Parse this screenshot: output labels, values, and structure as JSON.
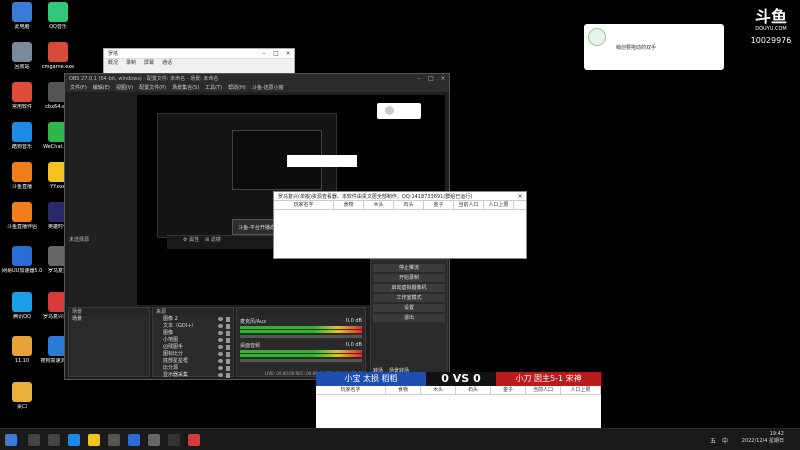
{
  "desktop_icons": [
    {
      "label": "此电脑",
      "color": "#3a7bd5"
    },
    {
      "label": "QQ音乐",
      "color": "#30c77a"
    },
    {
      "label": "回收站",
      "color": "#7a8a9a"
    },
    {
      "label": "cmgame.exe",
      "color": "#d64b3b"
    },
    {
      "label": "常用软件",
      "color": "#e04a3a"
    },
    {
      "label": "cbx64.exe",
      "color": "#555555"
    },
    {
      "label": "酷狗音乐",
      "color": "#1a8ce8"
    },
    {
      "label": "WeChat.exe",
      "color": "#2db64b"
    },
    {
      "label": "斗鱼直播",
      "color": "#f07d1a"
    },
    {
      "label": "YY.exe",
      "color": "#f4c21f"
    },
    {
      "label": "斗鱼直播伴侣",
      "color": "#f07d1a"
    },
    {
      "label": "英雄时代",
      "color": "#2a2a6a"
    },
    {
      "label": "网易UU加速器5.0",
      "color": "#2a6bd5"
    },
    {
      "label": "罗马复兴",
      "color": "#666666"
    },
    {
      "label": "腾讯QQ",
      "color": "#1aa0e8"
    },
    {
      "label": "罗马复兴单搬",
      "color": "#d63a3a"
    },
    {
      "label": "11.10",
      "color": "#e8a23a"
    },
    {
      "label": "搜狗高速浏览器",
      "color": "#2a7bd5"
    },
    {
      "label": "桌口",
      "color": "#e8b23a"
    }
  ],
  "miniwin": {
    "title": "罗塔",
    "tabs": [
      "概况",
      "录制",
      "屏幕",
      "通话"
    ]
  },
  "obs": {
    "title": "OBS 27.0.1 (64-bit, windows) - 配置文件: 未命名 - 场景: 未命名",
    "menu": [
      "文件(F)",
      "编辑(E)",
      "视图(V)",
      "配置文件(P)",
      "场景集合(S)",
      "工具(T)",
      "帮助(H)",
      "斗鱼-还原小窗"
    ],
    "scenes_header": "场景",
    "sources_header": "来源",
    "scene_item": "场景",
    "no_selected": "未选择源",
    "properties": "属性",
    "filters": "滤镜",
    "sources": [
      "图像 2",
      "文本（GDI+）",
      "图像",
      "小地图",
      "凶残图手",
      "图标比分",
      "底部星星框",
      "比分源",
      "显示器采集"
    ],
    "mixer": {
      "ch1": "麦克风/Aux",
      "ch1_db": "0.0 dB",
      "ch2": "桌面音频",
      "ch2_db": "0.0 dB"
    },
    "controls": [
      "停止推流",
      "开始录制",
      "启动虚拟摄像机",
      "工作室模式",
      "设置",
      "退出"
    ],
    "transitions": [
      "转场",
      "场景转场"
    ],
    "status": "LIVE: 00:00:00  REC: 00:00:00  CPU: 12.0%, 30.00 fps"
  },
  "toast": "斗鱼-平台开播成功",
  "tracker": {
    "title": "罗马复兴(单搬)资源查看器，本软件由贵文居全部制作。QQ:1418733891(群组已运行)",
    "columns": [
      "玩家名字",
      "食物",
      "木头",
      "石头",
      "金子",
      "当前人口",
      "人口上限"
    ]
  },
  "score": {
    "left_team": "小宝 太损 稻稻",
    "left_score": "0",
    "mid": "VS",
    "right_score": "0",
    "right_team": "小刀 囡主5-1 宋神",
    "columns": [
      "玩家名字",
      "食物",
      "木头",
      "石头",
      "金子",
      "当前人口",
      "人口上限"
    ]
  },
  "notification": {
    "text": "萌创要拖动的双手"
  },
  "douyu": {
    "logo": "斗鱼",
    "sub": "DOUYU.COM",
    "room": "10029976"
  },
  "taskbar": {
    "time": "19:42",
    "date": "2022/12/4 星期日",
    "lang": "中",
    "ime": "五"
  }
}
